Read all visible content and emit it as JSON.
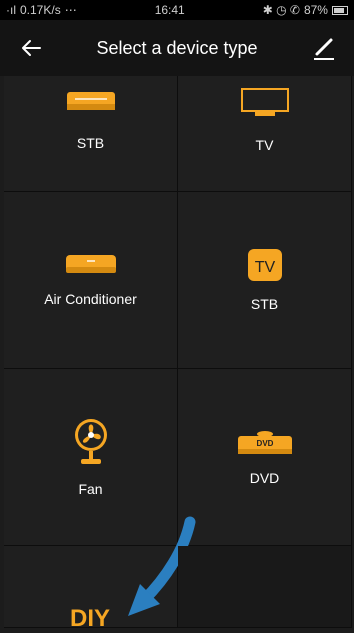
{
  "status_bar": {
    "signal": "·ıl",
    "speed": "0.17K/s",
    "extras": "⋯",
    "time": "16:41",
    "indicators": "✱ ◷ ✆",
    "battery": "87%"
  },
  "header": {
    "title": "Select a device type",
    "back_icon": "back-arrow-icon",
    "edit_icon": "edit-pencil-icon"
  },
  "accent_color": "#f5a623",
  "devices": [
    {
      "label": "STB",
      "icon": "set-top-box-icon"
    },
    {
      "label": "TV",
      "icon": "tv-icon"
    },
    {
      "label": "Air Conditioner",
      "icon": "air-conditioner-icon"
    },
    {
      "label": "STB",
      "icon": "tv-badge-icon",
      "badge": "TV"
    },
    {
      "label": "Fan",
      "icon": "fan-icon"
    },
    {
      "label": "DVD",
      "icon": "dvd-icon",
      "badge": "DVD"
    },
    {
      "label": "DIY",
      "icon": "diy-icon"
    }
  ]
}
